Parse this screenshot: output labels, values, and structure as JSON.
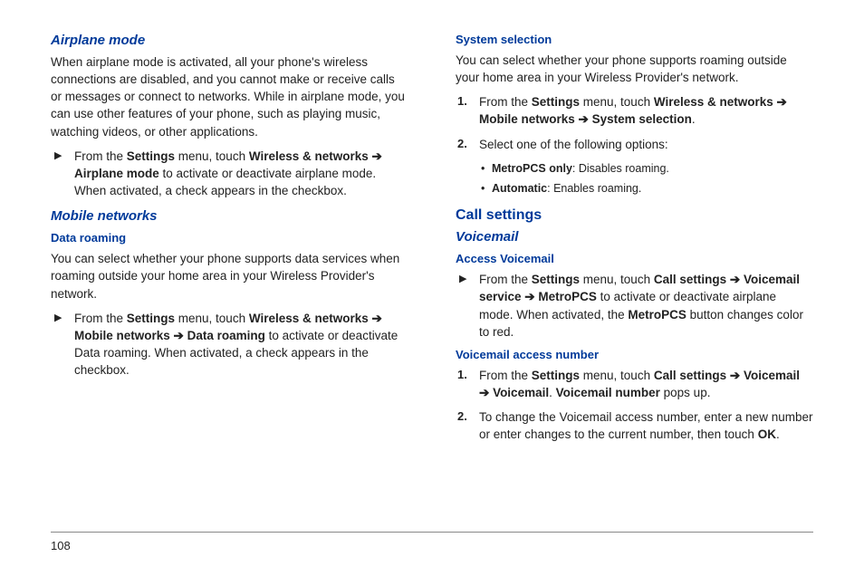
{
  "page_number": "108",
  "left": {
    "airplane": {
      "heading": "Airplane mode",
      "para": "When airplane mode is activated, all your phone's wireless connections are disabled, and you cannot make or receive calls or messages or connect to networks.  While in airplane mode, you can use other features of your phone, such as playing music, watching videos, or other applications.",
      "step_prefix": "From the ",
      "settings": "Settings",
      "step_mid": " menu, touch ",
      "path1": "Wireless & networks",
      "arrow": " ➔ ",
      "path2": "Airplane mode",
      "step_tail": " to activate or deactivate airplane mode. When activated, a check appears in the checkbox."
    },
    "mobile": {
      "heading": "Mobile networks",
      "sub": "Data roaming",
      "para": "You can select whether your phone supports data services when roaming outside your home area in your Wireless Provider's network.",
      "step_prefix": "From the ",
      "settings": "Settings",
      "step_mid": " menu, touch ",
      "path1": "Wireless & networks",
      "arrow": " ➔ ",
      "path2": "Mobile networks",
      "path3": "Data roaming",
      "step_tail": " to activate or deactivate Data roaming. When activated, a check appears in the checkbox."
    }
  },
  "right": {
    "system": {
      "heading": "System selection",
      "para": "You can select whether your phone supports roaming outside your home area in your Wireless Provider's network.",
      "s1_prefix": "From the ",
      "settings": "Settings",
      "s1_mid": " menu, touch ",
      "path1": "Wireless & networks",
      "arrow": " ➔ ",
      "path2": "Mobile networks",
      "path3": "System selection",
      "dot": ".",
      "s2": "Select one of the following options:",
      "opt1_b": "MetroPCS only",
      "opt1_t": ": Disables roaming.",
      "opt2_b": "Automatic",
      "opt2_t": ": Enables roaming."
    },
    "call": {
      "heading": "Call settings",
      "voicemail": "Voicemail",
      "access": "Access Voicemail",
      "av_prefix": "From the ",
      "settings": "Settings",
      "av_mid": " menu, touch ",
      "path1": "Call settings",
      "arrow": " ➔ ",
      "path2": "Voicemail service",
      "path3": "MetroPCS",
      "av_tail1": " to activate or deactivate airplane mode. When activated, the ",
      "metro": "MetroPCS",
      "av_tail2": " button changes color to red.",
      "van_heading": "Voicemail access number",
      "van1_prefix": "From the ",
      "van1_mid": " menu, touch ",
      "vpath1": "Call settings",
      "vpath2": "Voicemail",
      "vpath3": "Voicemail",
      "van1_dot": ". ",
      "vnum": "Voicemail number",
      "van1_tail": " pops up.",
      "van2": "To change the Voicemail access number, enter a new number or enter changes to the current number, then touch ",
      "ok": "OK",
      "van2_dot": "."
    }
  }
}
